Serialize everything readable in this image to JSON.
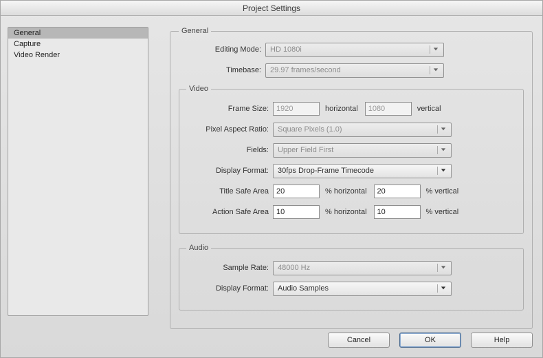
{
  "window": {
    "title": "Project Settings"
  },
  "sidebar": {
    "items": [
      {
        "label": "General",
        "selected": true
      },
      {
        "label": "Capture",
        "selected": false
      },
      {
        "label": "Video Render",
        "selected": false
      }
    ]
  },
  "general": {
    "legend": "General",
    "editing_mode": {
      "label": "Editing Mode:",
      "value": "HD 1080i",
      "enabled": false
    },
    "timebase": {
      "label": "Timebase:",
      "value": "29.97 frames/second",
      "enabled": false
    },
    "video": {
      "legend": "Video",
      "frame_size": {
        "label": "Frame Size:",
        "width": "1920",
        "height": "1080",
        "h_label": "horizontal",
        "v_label": "vertical",
        "enabled": false
      },
      "pixel_aspect": {
        "label": "Pixel Aspect Ratio:",
        "value": "Square Pixels (1.0)",
        "enabled": false
      },
      "fields": {
        "label": "Fields:",
        "value": "Upper Field First",
        "enabled": false
      },
      "display_format": {
        "label": "Display Format:",
        "value": "30fps Drop-Frame Timecode",
        "enabled": true
      },
      "title_safe": {
        "label": "Title Safe Area",
        "h": "20",
        "v": "20",
        "h_unit": "% horizontal",
        "v_unit": "% vertical"
      },
      "action_safe": {
        "label": "Action Safe Area",
        "h": "10",
        "v": "10",
        "h_unit": "% horizontal",
        "v_unit": "% vertical"
      }
    },
    "audio": {
      "legend": "Audio",
      "sample_rate": {
        "label": "Sample Rate:",
        "value": "48000 Hz",
        "enabled": false
      },
      "display_format": {
        "label": "Display Format:",
        "value": "Audio Samples",
        "enabled": true
      }
    }
  },
  "buttons": {
    "cancel": "Cancel",
    "ok": "OK",
    "help": "Help"
  }
}
